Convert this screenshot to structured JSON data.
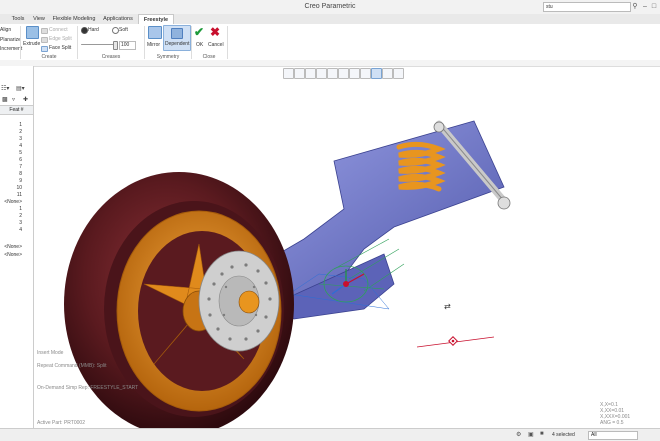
{
  "window": {
    "title": "Creo Parametric",
    "search_value": "stu"
  },
  "tabs": [
    "Tools",
    "View",
    "Flexible Modeling",
    "Applications",
    "Freestyle"
  ],
  "active_tab": "Freestyle",
  "ribbon": {
    "control": {
      "items": [
        "Align",
        "Planarize",
        "Increment"
      ]
    },
    "create": {
      "extrude": "Extrude",
      "connect": "Connect",
      "edge_split": "Edge Split",
      "face_split": "Face Split",
      "label": "Create"
    },
    "creases": {
      "hard": "Hard",
      "soft": "Soft",
      "value": "100",
      "label": "Creases"
    },
    "symmetry": {
      "mirror": "Mirror",
      "dependent": "Dependent",
      "label": "Symmetry"
    },
    "close": {
      "ok": "OK",
      "cancel": "Cancel",
      "label": "Close"
    }
  },
  "model_tree": {
    "header": "Feat #",
    "rows": [
      "1",
      "2",
      "3",
      "4",
      "5",
      "6",
      "7",
      "8",
      "9",
      "10",
      "11",
      "<None>",
      "1",
      "2",
      "3",
      "4",
      "<None>",
      "<None>"
    ]
  },
  "messages": [
    "Insert Mode",
    "Repeat Command (MMB): Split",
    "On-Demand Simp Rep: FREESTYLE_START",
    "Active Part: PRT0002"
  ],
  "coords": [
    "X,X=0.1",
    "X,XX=0.01",
    "X,XXX=0.001",
    "ANG = 0.5"
  ],
  "status": {
    "selected": "4 selected",
    "filter": "All"
  },
  "colors": {
    "tire": "#5a1a1f",
    "rim": "#e08a1c",
    "swingarm": "#6a72c8",
    "spring": "#e8951f",
    "accent_green": "#1d9a3a",
    "accent_red": "#c8102e"
  }
}
